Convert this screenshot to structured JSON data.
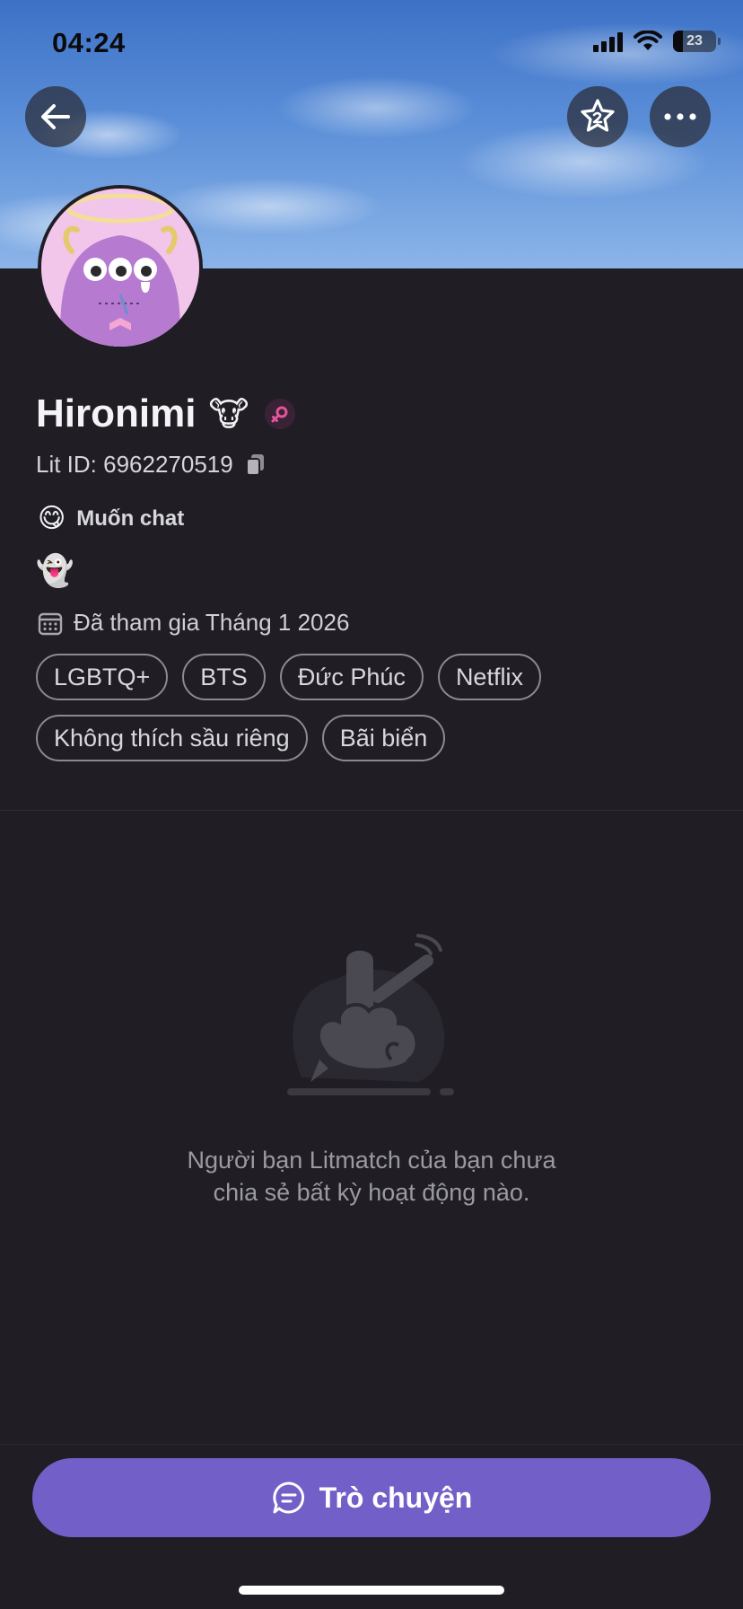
{
  "status_bar": {
    "time": "04:24",
    "battery": "23"
  },
  "header": {
    "back_icon": "arrow-left-icon",
    "favorite_icon": "star-badge-icon",
    "more_icon": "ellipsis-icon"
  },
  "profile": {
    "name": "Hironimi",
    "name_emoji": "🐮",
    "gender_icon": "female-symbol-icon",
    "lit_id": "Lit ID: 6962270519",
    "mood_emoji": "😋",
    "mood_text": "Muốn chat",
    "bio": "👻",
    "joined": "Đã tham gia Tháng 1 2026",
    "tags": [
      "LGBTQ+",
      "BTS",
      "Đức Phúc",
      "Netflix",
      "Không thích sầu riêng",
      "Bãi biển"
    ]
  },
  "empty_state": {
    "line1": "Người bạn Litmatch của bạn chưa",
    "line2": "chia sẻ bất kỳ hoạt động nào."
  },
  "actions": {
    "chat_label": "Trò chuyện"
  },
  "colors": {
    "background": "#201e24",
    "accent": "#735fc8",
    "gender_pink": "#e2559b"
  }
}
